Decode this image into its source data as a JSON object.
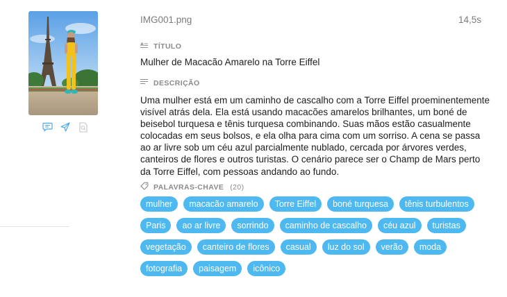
{
  "file": {
    "name": "IMG001.png",
    "duration": "14,5s"
  },
  "thumbnail": {
    "image_icon": "photo-eiffel-tower-woman"
  },
  "actions": {
    "icons": [
      "comment-icon",
      "send-icon",
      "document-search-icon"
    ]
  },
  "title_section": {
    "label": "TÍTULO",
    "icon": "text-format-icon",
    "value": "Mulher de Macacão Amarelo na Torre Eiffel"
  },
  "description_section": {
    "label": "DESCRIÇÃO",
    "icon": "lines-icon",
    "value": "Uma mulher está em um caminho de cascalho com a Torre Eiffel proeminentemente visível atrás dela. Ela está usando macacões amarelos brilhantes, um boné de beisebol turquesa e tênis turquesa combinando. Suas mãos estão casualmente colocadas em seus bolsos, e ela olha para cima com um sorriso. A cena se passa ao ar livre sob um céu azul parcialmente nublado, cercada por árvores verdes, canteiros de flores e outros turistas. O cenário parece ser o Champ de Mars perto da Torre Eiffel, com pessoas andando ao fundo."
  },
  "keywords_section": {
    "label": "PALAVRAS-CHAVE",
    "count": "(20)",
    "icon": "tag-icon",
    "items": [
      "mulher",
      "macacão amarelo",
      "Torre Eiffel",
      "boné turquesa",
      "tênis turbulentos",
      "Paris",
      "ao ar livre",
      "sorrindo",
      "caminho de cascalho",
      "céu azul",
      "turistas",
      "vegetação",
      "canteiro de flores",
      "casual",
      "luz do sol",
      "verão",
      "moda",
      "fotografia",
      "paisagem",
      "icônico"
    ]
  },
  "colors": {
    "chip": "#4eb8f0",
    "action_icon": "#4ba6e8",
    "muted_text": "#8a8a8e"
  }
}
